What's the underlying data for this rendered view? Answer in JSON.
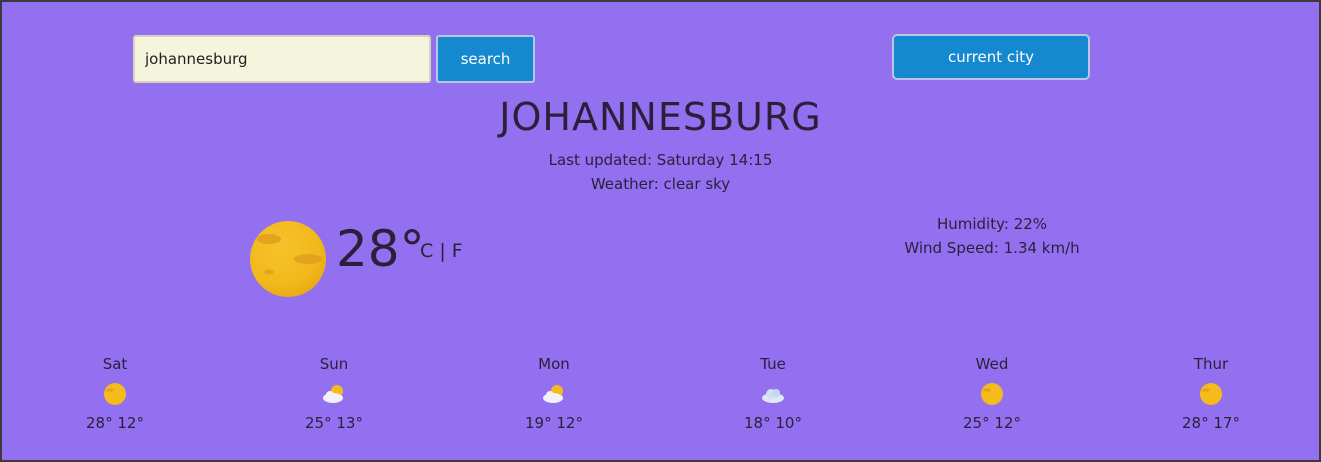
{
  "search": {
    "value": "johannesburg",
    "button_label": "search"
  },
  "current_city_button": "current city",
  "city": "JOHANNESBURG",
  "last_updated": "Last updated: Saturday 14:15",
  "weather_desc": "Weather: clear sky",
  "current": {
    "temperature": "28°",
    "unit_c": "C",
    "unit_sep": "|",
    "unit_f": "F",
    "icon": "sun-icon"
  },
  "humidity": "Humidity: 22%",
  "wind": "Wind Speed: 1.34 km/h",
  "forecast": [
    {
      "day": "Sat",
      "icon": "sun-icon",
      "temps": "28° 12°"
    },
    {
      "day": "Sun",
      "icon": "partly-cloudy-icon",
      "temps": "25° 13°"
    },
    {
      "day": "Mon",
      "icon": "partly-cloudy-icon",
      "temps": "19° 12°"
    },
    {
      "day": "Tue",
      "icon": "cloud-icon",
      "temps": "18° 10°"
    },
    {
      "day": "Wed",
      "icon": "sun-icon",
      "temps": "25° 12°"
    },
    {
      "day": "Thur",
      "icon": "sun-icon",
      "temps": "28° 17°"
    }
  ],
  "colors": {
    "background": "#9370f0",
    "button": "#1489cf",
    "input_bg": "#f5f4dc",
    "text": "#2b1f3a",
    "sun": "#f5bb1a"
  }
}
